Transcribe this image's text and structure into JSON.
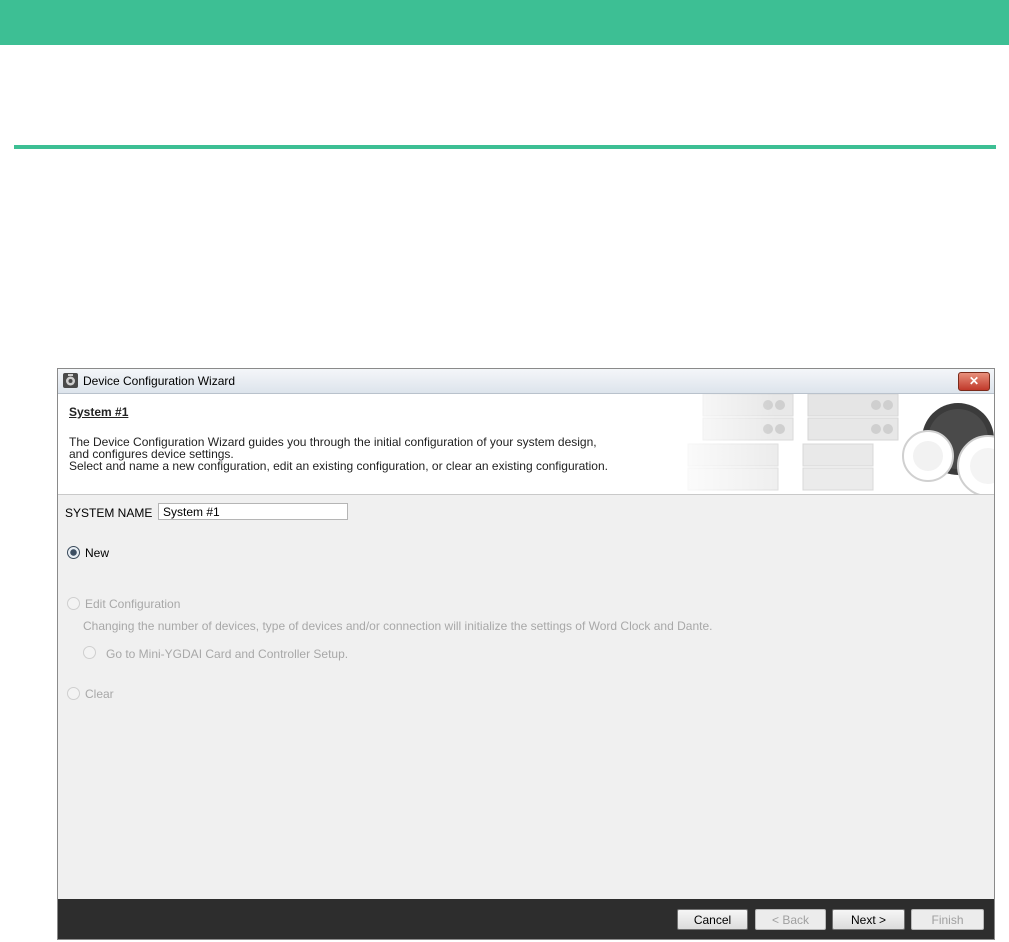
{
  "window": {
    "title": "Device Configuration Wizard",
    "close_glyph": "✕"
  },
  "header": {
    "title": "System #1",
    "description": [
      "The Device Configuration Wizard guides you through the initial configuration of your system design,",
      "and configures device settings.",
      "Select and name a new configuration, edit an existing configuration, or clear an existing configuration."
    ]
  },
  "system_name": {
    "label": "SYSTEM NAME",
    "value": "System #1"
  },
  "options": {
    "new": {
      "label": "New",
      "selected": true
    },
    "edit": {
      "label": "Edit Configuration",
      "note": "Changing the number of devices, type of devices and/or connection will initialize the settings of Word Clock and Dante.",
      "enabled": false
    },
    "mini_ygdai": {
      "label": "Go to Mini-YGDAI Card and Controller Setup.",
      "enabled": false
    },
    "clear": {
      "label": "Clear",
      "enabled": false
    }
  },
  "buttons": {
    "cancel": "Cancel",
    "back": "< Back",
    "next": "Next >",
    "finish": "Finish"
  },
  "colors": {
    "accent_green": "#3dbf94",
    "footer_bg": "#2d2d2d",
    "disabled_text": "#a8a8a8"
  }
}
